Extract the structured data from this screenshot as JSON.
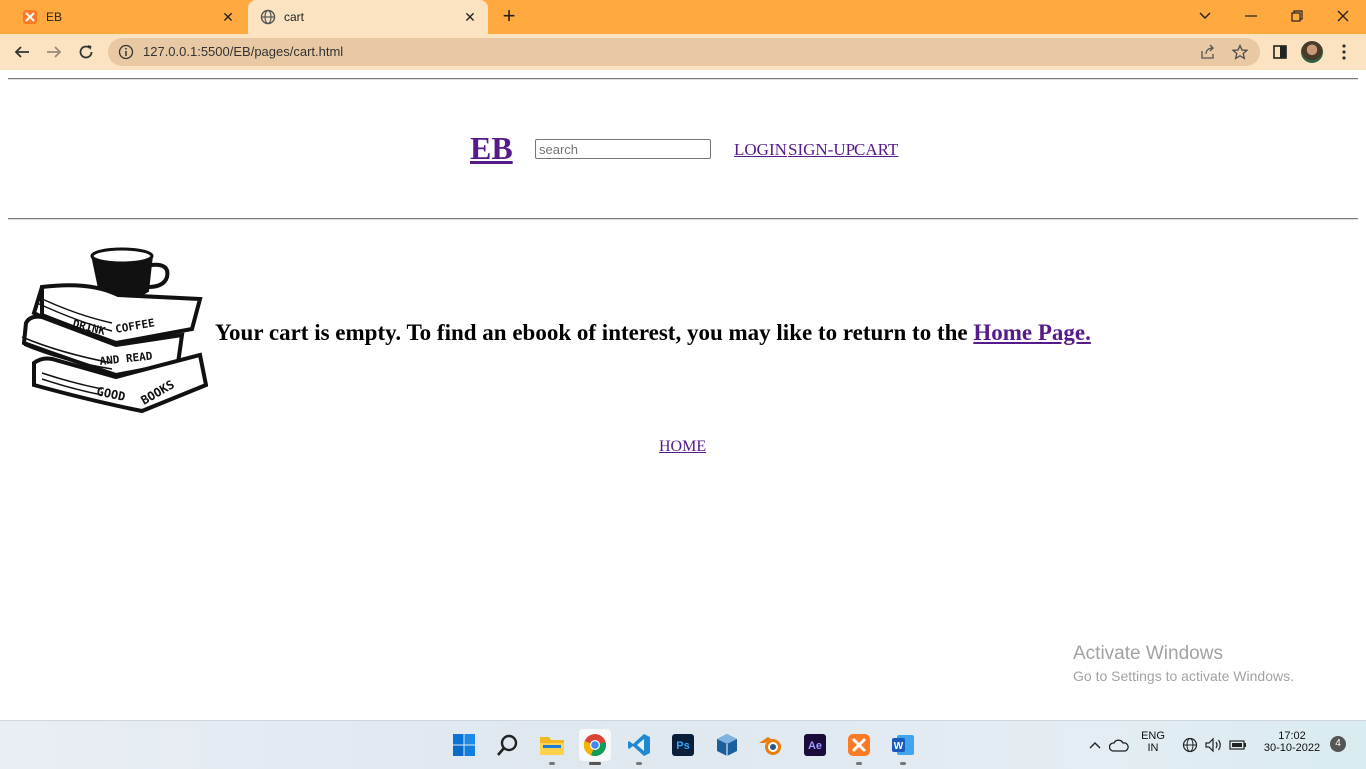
{
  "browser": {
    "tabs": [
      {
        "label": "EB",
        "icon": "xampp-icon",
        "active": false
      },
      {
        "label": "cart",
        "icon": "globe-icon",
        "active": true
      }
    ],
    "url": "127.0.0.1:5500/EB/pages/cart.html",
    "accent": "#ffa93f",
    "toolbar_color": "#fbe3c2"
  },
  "page": {
    "brand": "EB",
    "search": {
      "placeholder": "search",
      "value": ""
    },
    "nav": {
      "login": "LOGIN",
      "signup": "SIGN-UP",
      "cart": "CART"
    },
    "image": {
      "lines": [
        "DRINK",
        "COFFEE",
        "AND READ",
        "GOOD",
        "BOOKS"
      ]
    },
    "message": {
      "text": "Your cart is empty. To find an ebook of interest, you may like to return to the ",
      "link": "Home Page."
    },
    "footer_link": "HOME",
    "link_color": "#551a8b"
  },
  "watermark": {
    "title": "Activate Windows",
    "subtitle": "Go to Settings to activate Windows."
  },
  "taskbar": {
    "apps": [
      "windows-start-icon",
      "search-icon",
      "file-explorer-icon",
      "chrome-icon",
      "vscode-icon",
      "photoshop-icon",
      "virtualbox-icon",
      "blender-icon",
      "after-effects-icon",
      "xampp-icon",
      "word-icon"
    ],
    "ps_label": "Ps",
    "ae_label": "Ae",
    "word_label": "W",
    "language": "ENG",
    "region": "IN",
    "time": "17:02",
    "date": "30-10-2022",
    "notifications": "4"
  }
}
